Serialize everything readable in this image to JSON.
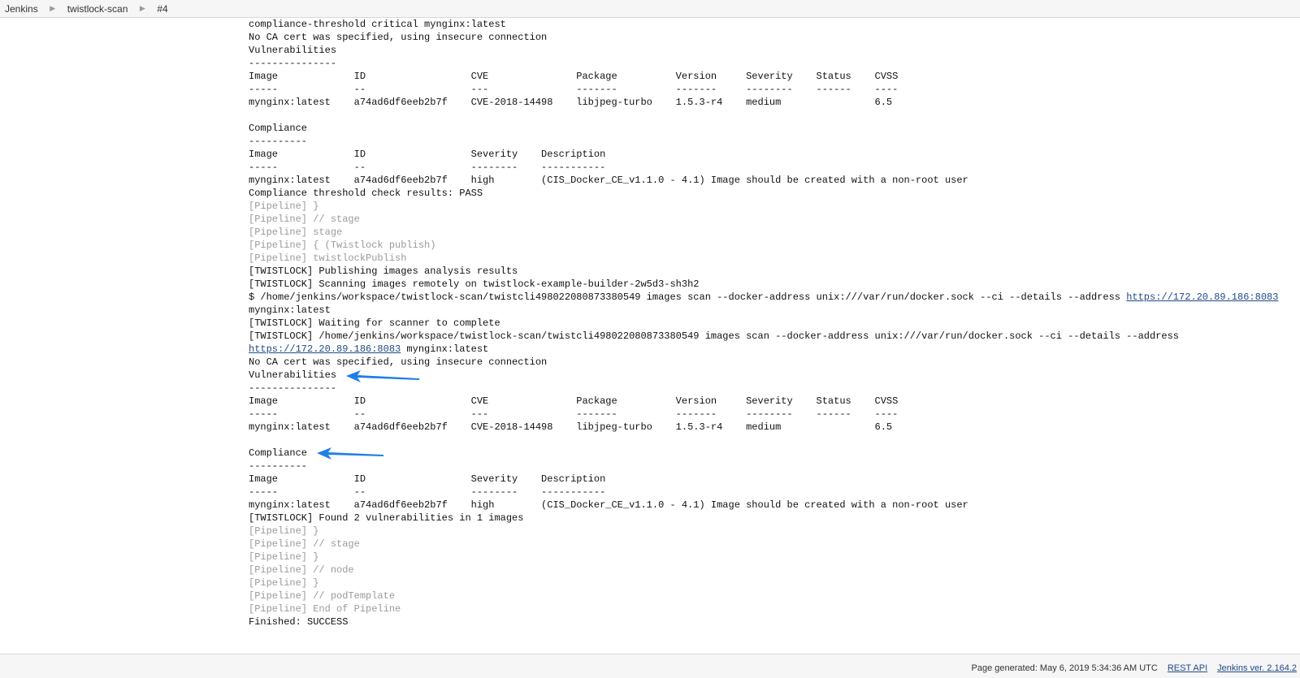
{
  "breadcrumb": [
    "Jenkins",
    "twistlock-scan",
    "#4"
  ],
  "console": {
    "lines": [
      {
        "text": "compliance-threshold critical mynginx:latest",
        "kind": "out"
      },
      {
        "text": "No CA cert was specified, using insecure connection",
        "kind": "out"
      },
      {
        "text": "Vulnerabilities",
        "kind": "out"
      },
      {
        "text": "---------------",
        "kind": "out"
      },
      {
        "text": "Image             ID                  CVE               Package          Version     Severity    Status    CVSS",
        "kind": "out"
      },
      {
        "text": "-----             --                  ---               -------          -------     --------    ------    ----",
        "kind": "out"
      },
      {
        "text": "mynginx:latest    a74ad6df6eeb2b7f    CVE-2018-14498    libjpeg-turbo    1.5.3-r4    medium                6.5",
        "kind": "out"
      },
      {
        "text": "",
        "kind": "blank"
      },
      {
        "text": "Compliance",
        "kind": "out"
      },
      {
        "text": "----------",
        "kind": "out"
      },
      {
        "text": "Image             ID                  Severity    Description",
        "kind": "out"
      },
      {
        "text": "-----             --                  --------    -----------",
        "kind": "out"
      },
      {
        "text": "mynginx:latest    a74ad6df6eeb2b7f    high        (CIS_Docker_CE_v1.1.0 - 4.1) Image should be created with a non-root user",
        "kind": "out"
      },
      {
        "text": "Compliance threshold check results: PASS",
        "kind": "out"
      },
      {
        "text": "[Pipeline] }",
        "kind": "pipe"
      },
      {
        "text": "[Pipeline] // stage",
        "kind": "pipe"
      },
      {
        "text": "[Pipeline] stage",
        "kind": "pipe"
      },
      {
        "text": "[Pipeline] { (Twistlock publish)",
        "kind": "pipe"
      },
      {
        "text": "[Pipeline] twistlockPublish",
        "kind": "pipe"
      },
      {
        "text": "[TWISTLOCK] Publishing images analysis results",
        "kind": "out"
      },
      {
        "text": "[TWISTLOCK] Scanning images remotely on twistlock-example-builder-2w5d3-sh3h2",
        "kind": "out"
      },
      {
        "text": "$ /home/jenkins/workspace/twistlock-scan/twistcli498022080873380549 images scan --docker-address unix:///var/run/docker.sock --ci --details --address ",
        "kind": "out",
        "link": "https://172.20.89.186:8083"
      },
      {
        "text": "mynginx:latest",
        "kind": "out"
      },
      {
        "text": "[TWISTLOCK] Waiting for scanner to complete",
        "kind": "out"
      },
      {
        "text": "[TWISTLOCK] /home/jenkins/workspace/twistlock-scan/twistcli498022080873380549 images scan --docker-address unix:///var/run/docker.sock --ci --details --address",
        "kind": "out"
      },
      {
        "text": "",
        "kind": "out",
        "link": "https://172.20.89.186:8083",
        "after": " mynginx:latest"
      },
      {
        "text": "No CA cert was specified, using insecure connection",
        "kind": "out"
      },
      {
        "text": "Vulnerabilities",
        "kind": "out"
      },
      {
        "text": "---------------",
        "kind": "out"
      },
      {
        "text": "Image             ID                  CVE               Package          Version     Severity    Status    CVSS",
        "kind": "out"
      },
      {
        "text": "-----             --                  ---               -------          -------     --------    ------    ----",
        "kind": "out"
      },
      {
        "text": "mynginx:latest    a74ad6df6eeb2b7f    CVE-2018-14498    libjpeg-turbo    1.5.3-r4    medium                6.5",
        "kind": "out"
      },
      {
        "text": "",
        "kind": "blank"
      },
      {
        "text": "Compliance",
        "kind": "out"
      },
      {
        "text": "----------",
        "kind": "out"
      },
      {
        "text": "Image             ID                  Severity    Description",
        "kind": "out"
      },
      {
        "text": "-----             --                  --------    -----------",
        "kind": "out"
      },
      {
        "text": "mynginx:latest    a74ad6df6eeb2b7f    high        (CIS_Docker_CE_v1.1.0 - 4.1) Image should be created with a non-root user",
        "kind": "out"
      },
      {
        "text": "[TWISTLOCK] Found 2 vulnerabilities in 1 images",
        "kind": "out"
      },
      {
        "text": "[Pipeline] }",
        "kind": "pipe"
      },
      {
        "text": "[Pipeline] // stage",
        "kind": "pipe"
      },
      {
        "text": "[Pipeline] }",
        "kind": "pipe"
      },
      {
        "text": "[Pipeline] // node",
        "kind": "pipe"
      },
      {
        "text": "[Pipeline] }",
        "kind": "pipe"
      },
      {
        "text": "[Pipeline] // podTemplate",
        "kind": "pipe"
      },
      {
        "text": "[Pipeline] End of Pipeline",
        "kind": "pipe"
      },
      {
        "text": "Finished: SUCCESS",
        "kind": "out"
      }
    ]
  },
  "annotations": {
    "arrow_color": "#1e7fe8",
    "arrows": [
      {
        "points_at": "Vulnerabilities"
      },
      {
        "points_at": "Compliance"
      }
    ]
  },
  "footer": {
    "page_generated": "Page generated: May 6, 2019 5:34:36 AM UTC",
    "rest_api": "REST API",
    "version": "Jenkins ver. 2.164.2"
  }
}
